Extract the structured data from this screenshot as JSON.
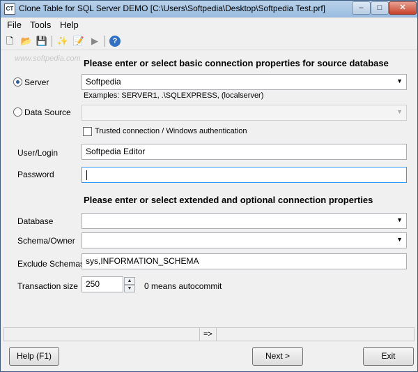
{
  "window": {
    "title": "Clone Table for SQL Server DEMO [C:\\Users\\Softpedia\\Desktop\\Softpedia Test.prf]",
    "app_icon_text": "CT"
  },
  "menu": [
    "File",
    "Tools",
    "Help"
  ],
  "watermark": "www.softpedia.com",
  "basic": {
    "heading": "Please enter or select basic connection properties for source database",
    "server_label": "Server",
    "server_value": "Softpedia",
    "server_examples": "Examples: SERVER1, .\\SQLEXPRESS, (localserver)",
    "datasource_label": "Data Source",
    "datasource_value": "",
    "trusted_label": "Trusted connection / Windows authentication",
    "user_label": "User/Login",
    "user_value": "Softpedia Editor",
    "password_label": "Password",
    "password_value": ""
  },
  "extended": {
    "heading": "Please enter or select extended and optional connection properties",
    "database_label": "Database",
    "database_value": "",
    "schema_label": "Schema/Owner",
    "schema_value": "",
    "exclude_label": "Exclude Schemas",
    "exclude_value": "sys,INFORMATION_SCHEMA",
    "transaction_label": "Transaction size",
    "transaction_value": "250",
    "transaction_hint": "0 means autocommit"
  },
  "status": {
    "text": "=>"
  },
  "buttons": {
    "help": "Help (F1)",
    "next": "Next >",
    "exit": "Exit"
  },
  "icons": {
    "new": "🗋",
    "open": "📂",
    "save": "💾",
    "wizard": "✨",
    "edit": "📝",
    "run": "▶",
    "help": "?"
  }
}
